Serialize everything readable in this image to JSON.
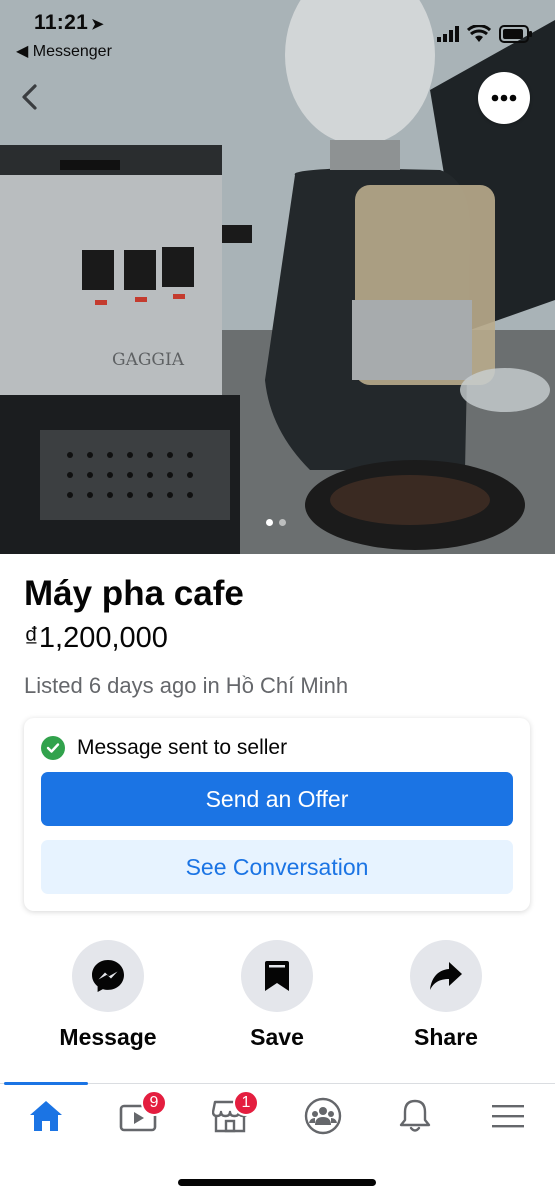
{
  "status_bar": {
    "time": "11:21",
    "back_app": "◀ Messenger"
  },
  "listing": {
    "title": "Máy pha cafe",
    "price": "₫1,200,000",
    "listed": "Listed 6 days ago in Hồ Chí Minh"
  },
  "photo": {
    "brand_text": "GAGGIA",
    "page_count": 2,
    "current_page": 1
  },
  "seller_card": {
    "status": "Message sent to seller",
    "primary_button": "Send an Offer",
    "secondary_button": "See Conversation"
  },
  "actions": [
    {
      "label": "Message",
      "icon": "messenger-icon"
    },
    {
      "label": "Save",
      "icon": "bookmark-icon"
    },
    {
      "label": "Share",
      "icon": "share-arrow-icon"
    }
  ],
  "bottom_nav": {
    "items": [
      {
        "icon": "home-icon",
        "active": true
      },
      {
        "icon": "watch-video-icon",
        "badge": "9"
      },
      {
        "icon": "marketplace-icon",
        "badge": "1"
      },
      {
        "icon": "groups-icon"
      },
      {
        "icon": "bell-icon"
      },
      {
        "icon": "menu-icon"
      }
    ]
  },
  "colors": {
    "accent": "#1b74e4",
    "accent_light": "#e7f3ff",
    "success": "#31a24c",
    "badge": "#e41e3f",
    "secondary_text": "#65676b"
  }
}
